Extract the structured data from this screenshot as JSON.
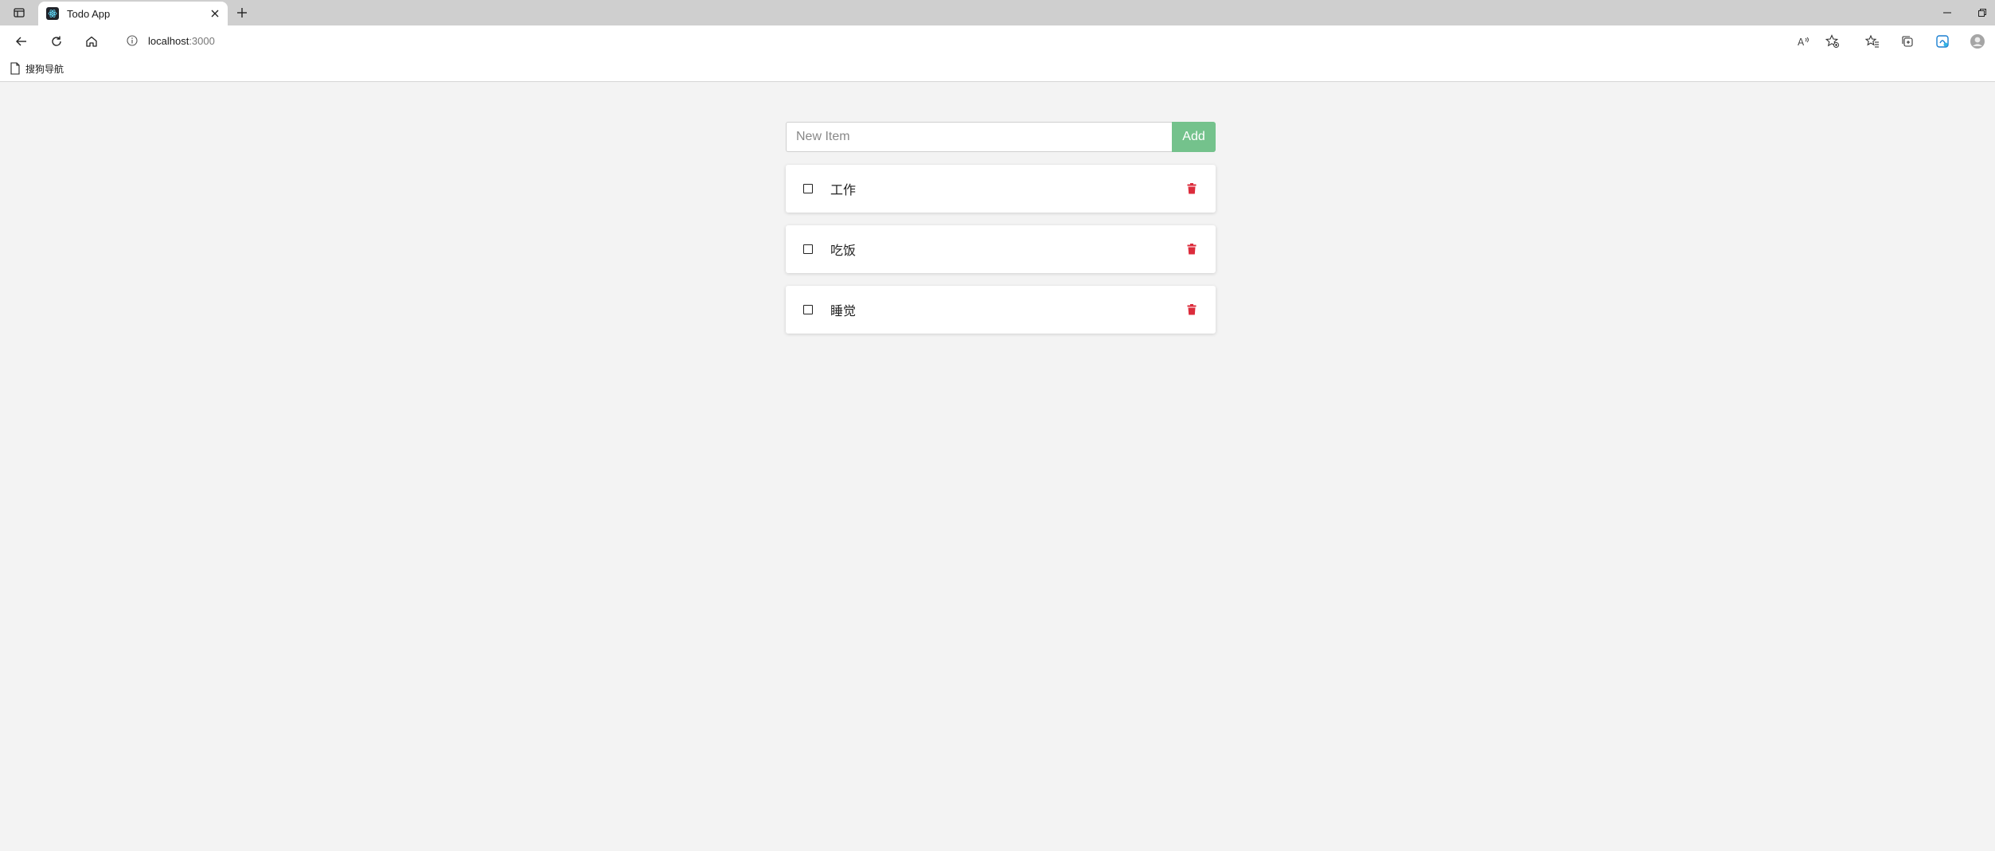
{
  "browser": {
    "tab": {
      "title": "Todo App"
    },
    "address": {
      "host": "localhost",
      "port": ":3000"
    },
    "bookmarks": [
      {
        "label": "搜狗导航"
      }
    ]
  },
  "app": {
    "new_item": {
      "placeholder": "New Item",
      "value": ""
    },
    "add_label": "Add",
    "items": [
      {
        "text": "工作",
        "done": false
      },
      {
        "text": "吃饭",
        "done": false
      },
      {
        "text": "睡觉",
        "done": false
      }
    ],
    "colors": {
      "add_button": "#74c28c",
      "delete_icon": "#dc2c3c",
      "background": "#f3f3f3"
    }
  }
}
